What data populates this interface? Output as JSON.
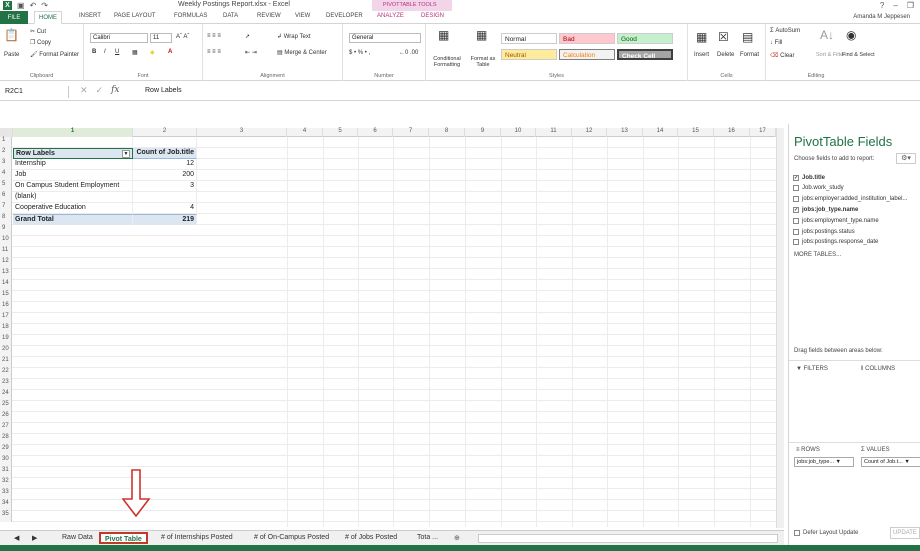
{
  "window": {
    "title": "Weekly Postings Report.xlsx - Excel",
    "context_label": "PIVOTTABLE TOOLS",
    "user": "Amanda M Jeppesen"
  },
  "ribbon_tabs": [
    "FILE",
    "HOME",
    "INSERT",
    "PAGE LAYOUT",
    "FORMULAS",
    "DATA",
    "REVIEW",
    "VIEW",
    "DEVELOPER",
    "ANALYZE",
    "DESIGN"
  ],
  "ribbon": {
    "clipboard": {
      "label": "Clipboard",
      "paste": "Paste",
      "cut": "Cut",
      "copy": "Copy",
      "format_painter": "Format Painter"
    },
    "font": {
      "label": "Font",
      "name": "Calibri",
      "size": "11"
    },
    "alignment": {
      "label": "Alignment",
      "wrap": "Wrap Text",
      "merge": "Merge & Center"
    },
    "number": {
      "label": "Number",
      "format": "General"
    },
    "styles": {
      "label": "Styles",
      "conditional": "Conditional Formatting",
      "format_table": "Format as Table",
      "normal": "Normal",
      "bad": "Bad",
      "good": "Good",
      "neutral": "Neutral",
      "calculation": "Calculation",
      "check_cell": "Check Cell"
    },
    "cells": {
      "label": "Cells",
      "insert": "Insert",
      "delete": "Delete",
      "format": "Format"
    },
    "editing": {
      "label": "Editing",
      "autosum": "AutoSum",
      "fill": "Fill",
      "clear": "Clear",
      "sort": "Sort & Filter",
      "find": "Find & Select"
    }
  },
  "formula_bar": {
    "name_box": "R2C1",
    "content": "Row Labels",
    "fx": "fx"
  },
  "columns": [
    "1",
    "2",
    "3",
    "4",
    "5",
    "6",
    "7",
    "8",
    "9",
    "10",
    "11",
    "12",
    "13",
    "14",
    "15",
    "16",
    "17"
  ],
  "rows": [
    "1",
    "2",
    "3",
    "4",
    "5",
    "6",
    "7",
    "8",
    "9",
    "10",
    "11",
    "12",
    "13",
    "14",
    "15",
    "16",
    "17",
    "18",
    "19",
    "20",
    "21",
    "22",
    "23",
    "24",
    "25",
    "26",
    "27",
    "28",
    "29",
    "30",
    "31",
    "32",
    "33",
    "34",
    "35"
  ],
  "pivot": {
    "header": {
      "label": "Row Labels",
      "value": "Count of Job.title"
    },
    "items": [
      {
        "label": "Internship",
        "value": "12"
      },
      {
        "label": "Job",
        "value": "200"
      },
      {
        "label": "On Campus Student Employment",
        "value": "3"
      },
      {
        "label": "(blank)",
        "value": ""
      },
      {
        "label": "Cooperative Education",
        "value": "4"
      }
    ],
    "total": {
      "label": "Grand Total",
      "value": "219"
    }
  },
  "sheet_tabs": [
    "Raw Data",
    "Pivot Table",
    "# of Internships Posted",
    "# of On-Campus Posted",
    "# of Jobs Posted",
    "Tota ..."
  ],
  "active_sheet": "Pivot Table",
  "panel": {
    "title": "PivotTable Fields",
    "subtitle": "Choose fields to add to report:",
    "fields": [
      {
        "name": "Job.title",
        "checked": true
      },
      {
        "name": "Job.work_study",
        "checked": false
      },
      {
        "name": "jobs:employer:added_institution_label...",
        "checked": false
      },
      {
        "name": "jobs:job_type.name",
        "checked": true
      },
      {
        "name": "jobs:employment_type.name",
        "checked": false
      },
      {
        "name": "jobs:postings.status",
        "checked": false
      },
      {
        "name": "jobs:postings.response_date",
        "checked": false
      }
    ],
    "more": "MORE TABLES...",
    "drag_hint": "Drag fields between areas below:",
    "filters": "FILTERS",
    "columns_label": "COLUMNS",
    "rows_label": "ROWS",
    "values_label": "VALUES",
    "rows_chip": "jobs:job_type...",
    "values_chip": "Count of Job.t...",
    "defer": "Defer Layout Update",
    "update": "UPDATE"
  }
}
